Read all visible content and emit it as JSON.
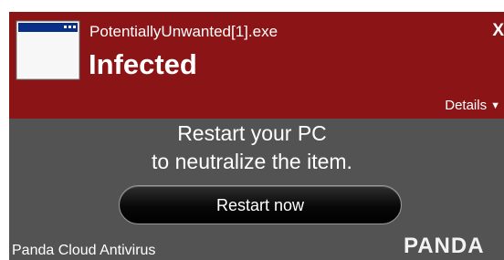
{
  "notification": {
    "filename": "PotentiallyUnwanted[1].exe",
    "status": "Infected",
    "close_label": "X",
    "details_label": "Details",
    "details_caret": "▼",
    "message_line1": "Restart your PC",
    "message_line2": "to neutralize the item.",
    "restart_button": "Restart now",
    "product_name": "Panda Cloud Antivirus",
    "brand_logo": "PANDA",
    "icons": {
      "file": "application-window-icon"
    }
  },
  "colors": {
    "header_background": "#8b1416",
    "body_background": "#535353",
    "button_background": "#000000",
    "text": "#ffffff"
  }
}
